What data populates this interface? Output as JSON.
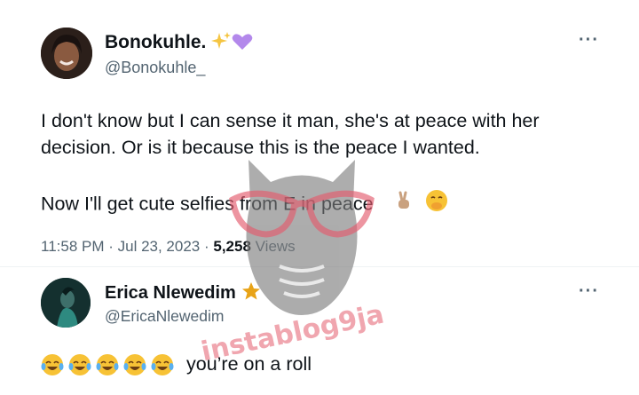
{
  "tweet1": {
    "display_name": "Bonokuhle.",
    "handle": "@Bonokuhle_",
    "line1": "I don't know but I can sense it man, she's at peace with her",
    "line2": "decision. Or is it because this is the peace I wanted.",
    "line3": "Now I'll get cute selfies from E in peace",
    "time_date": "11:58 PM · Jul 23, 2023 ·",
    "views_count": "5,258",
    "views_label": "Views",
    "more_label": "···",
    "name_emojis": [
      "sparkles-icon",
      "purple-heart-icon"
    ],
    "text_emojis": [
      "victory-hand-icon",
      "face-with-hand-over-mouth-icon"
    ]
  },
  "tweet2": {
    "display_name": "Erica Nlewedim",
    "handle": "@EricaNlewedim",
    "text": "you’re on a roll",
    "more_label": "···",
    "name_emojis": [
      "star-icon"
    ],
    "text_emojis": [
      "tears-of-joy-icon",
      "tears-of-joy-icon",
      "tears-of-joy-icon",
      "tears-of-joy-icon",
      "tears-of-joy-icon"
    ]
  },
  "watermark": {
    "text": "instablog9ja"
  },
  "colors": {
    "text": "#0f1419",
    "secondary": "#536471",
    "watermark": "#e45c6e",
    "owl": "#7a7a7a"
  }
}
